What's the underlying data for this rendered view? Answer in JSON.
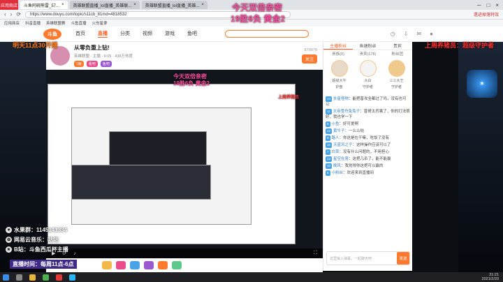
{
  "browser": {
    "badge": "应用商店",
    "tabs": [
      {
        "label": "斗鱼阿碗熊雷_57...",
        "active": true
      },
      {
        "label": "英雄联盟直播_lol直播_英雄联..."
      },
      {
        "label": "英雄联盟直播_lol直播_英雄..."
      }
    ],
    "url": "https://www.douyu.com/topic/s11cb_81md=4818532",
    "bookmarks": [
      "应用商店",
      "抖音直播",
      "英雄联盟赛",
      "斗鱼直播",
      "火车星拿"
    ],
    "banner_right": "遗迹掉落特效"
  },
  "site": {
    "logo": "斗鱼",
    "nav": [
      "首页",
      "直播",
      "分类",
      "视频",
      "游戏",
      "鱼吧"
    ]
  },
  "room": {
    "title": "从零负重上钻!",
    "sub": "英雄联盟 · 主播 · 6:05 · 438万热度",
    "tags": [
      "1级",
      "看吧",
      "鱼吧"
    ],
    "follow": "关注",
    "room_id": "870078"
  },
  "overlay": {
    "top_line1": "今天双倍亲密",
    "top_line2": "19胜6负 黄金2",
    "left_top": "明天11点30开播",
    "right_top": "上周养猪员：超级守护者",
    "mid_line1": "今天双倍亲密",
    "mid_line2": "19胜6负 黄金2",
    "mid_right": "上周养猪员",
    "list": [
      {
        "icon": "♥",
        "text": "水果群：1145141334"
      },
      {
        "icon": "✿",
        "text": "网易云音乐：咕咕"
      },
      {
        "icon": "★",
        "text": "B站：斗鱼西瓜杯主播"
      }
    ],
    "bottom": "直播时间：每周11点-6点"
  },
  "chat": {
    "tabs": [
      "主播粉丝",
      "鱼塘粉丝",
      "贵宾"
    ],
    "subtabs": [
      "贵族(0)",
      "贵宾(178)",
      "粉丝团"
    ],
    "rank": [
      {
        "name": "超级大牛",
        "role": "护盘"
      },
      {
        "name": "大白",
        "role": "守护者"
      },
      {
        "name": "三三大王",
        "role": "守护者"
      }
    ],
    "messages": [
      {
        "lv": "14",
        "nick": "外星怪物",
        "text": "能把普攻全都过了吗，没有也可以"
      },
      {
        "lv": "11",
        "nick": "天帝雪舟兔兔子",
        "text": "曾哥太厉害了，你的打法很好，我也学一下"
      },
      {
        "lv": "8",
        "nick": "小鱼",
        "text": "好可爱啊"
      },
      {
        "lv": "12",
        "nick": "黄牛子",
        "text": "一么么哒"
      },
      {
        "lv": "9",
        "nick": "路人",
        "text": "你这是在干嘛，吃饭了没有"
      },
      {
        "lv": "15",
        "nick": "天蓝风之子",
        "text": "这样操作应该可以了"
      },
      {
        "lv": "7",
        "nick": "白菜",
        "text": "没有什么问题的，不用担心"
      },
      {
        "lv": "13",
        "nick": "星空在旁",
        "text": "这把几杀了，能不能赢"
      },
      {
        "lv": "10",
        "nick": "晚风",
        "text": "我觉得你这把可以赢的"
      },
      {
        "lv": "6",
        "nick": "小粉丝",
        "text": "欢迎来到直播间"
      }
    ],
    "input_placeholder": "这里输入弹幕，一起聊天吧",
    "send": "发送"
  },
  "taskbar": {
    "time": "21:21",
    "date": "2021/2/20"
  }
}
